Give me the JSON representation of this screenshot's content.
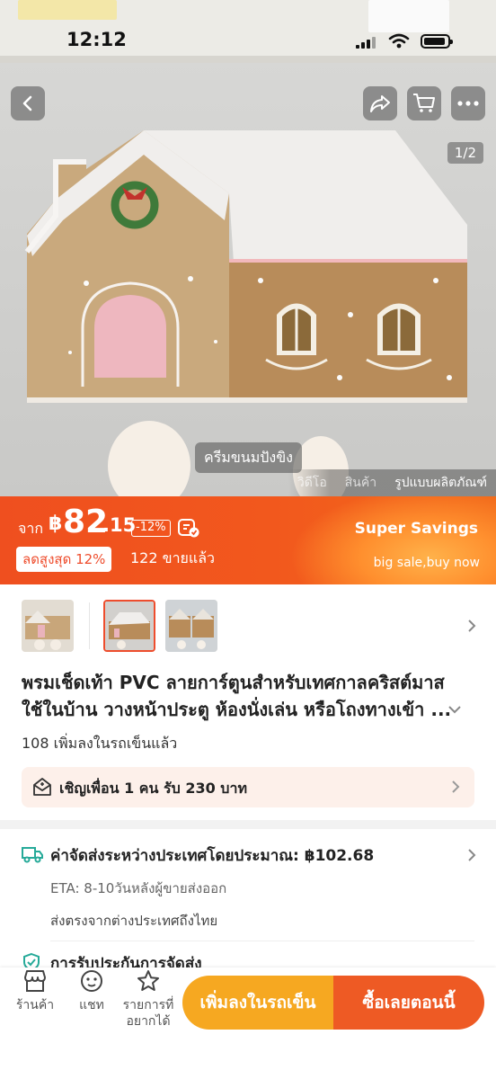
{
  "status_bar": {
    "time": "12:12"
  },
  "hero": {
    "image_counter": "1/2",
    "variant_chip": "ครีมขนมปังขิง",
    "media_tabs": [
      "วิดีโอ",
      "สินค้า",
      "รูปแบบผลิตภัณฑ์"
    ],
    "active_media_tab": 2
  },
  "price": {
    "from_label": "จาก",
    "currency": "฿",
    "integer": "82",
    "decimal": ".15",
    "discount": "-12%",
    "max_discount": "ลดสูงสุด 12%",
    "sold": "122 ขายแล้ว",
    "promo_title": "Super Savings",
    "promo_subtitle": "big sale,buy now"
  },
  "product": {
    "title": "พรมเช็ดเท้า PVC ลายการ์ตูนสำหรับเทศกาลคริสต์มาส ใช้ในบ้าน วางหน้าประตู ห้องนั่งเล่น หรือโถงทางเข้า ...",
    "cart_count": "108 เพิ่มลงในรถเข็นแล้ว",
    "invite": "เชิญเพื่อน 1 คน รับ 230 บาท"
  },
  "shipping": {
    "title": "ค่าจัดส่งระหว่างประเทศโดยประมาณ: ฿102.68",
    "eta": "ETA: 8-10วันหลังผู้ขายส่งออก",
    "direct": "ส่งตรงจากต่างประเทศถึงไทย",
    "insurance_title": "การรับประกันการจัดส่ง"
  },
  "bottom_bar": {
    "shop": "ร้านค้า",
    "chat": "แชท",
    "wishlist_line1": "รายการที่",
    "wishlist_line2": "อยากได้",
    "add_to_cart": "เพิ่มลงในรถเข็น",
    "buy_now": "ซื้อเลยตอนนี้"
  },
  "colors": {
    "accent": "#ee4d2d",
    "cart_button": "#f6a821",
    "buy_button": "#ee5a24",
    "ship_green": "#26aa99"
  }
}
